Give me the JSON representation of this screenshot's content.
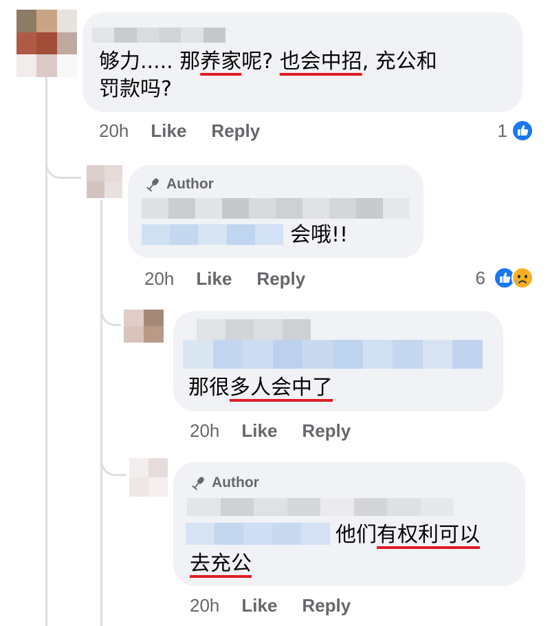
{
  "comments": [
    {
      "text_parts": [
        "够力..... 那",
        "养家",
        "呢? ",
        "也会中招",
        ", 充公和"
      ],
      "text_line2": "罚款吗?",
      "time": "20h",
      "like_label": "Like",
      "reply_label": "Reply",
      "reaction_count": "1",
      "reactions": [
        "like-icon"
      ]
    },
    {
      "author_badge": "Author",
      "text_tail": "会哦!!",
      "time": "20h",
      "like_label": "Like",
      "reply_label": "Reply",
      "reaction_count": "6",
      "reactions": [
        "like-icon",
        "sad-icon"
      ]
    },
    {
      "text_parts": [
        "那很",
        "多人会中了"
      ],
      "time": "20h",
      "like_label": "Like",
      "reply_label": "Reply"
    },
    {
      "author_badge": "Author",
      "text_parts": [
        "他们",
        "有权利可以"
      ],
      "text_line2": "去充公",
      "time": "20h",
      "like_label": "Like",
      "reply_label": "Reply"
    }
  ],
  "colors": {
    "bubble": "#f0f2f5",
    "meta_text": "#65676b",
    "underline": "#e01b24",
    "like_blue": "#1877f2",
    "sad_yellow": "#f7b125"
  }
}
